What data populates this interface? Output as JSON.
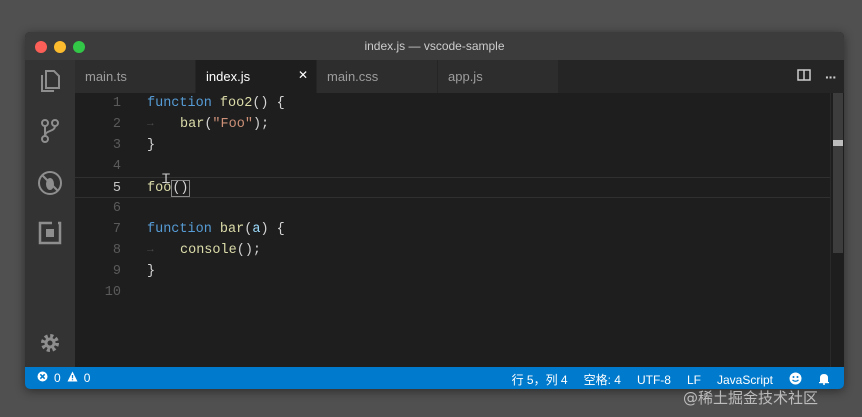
{
  "window": {
    "title": "index.js — vscode-sample"
  },
  "tabs": [
    {
      "label": "main.ts",
      "active": false
    },
    {
      "label": "index.js",
      "active": true
    },
    {
      "label": "main.css",
      "active": false
    },
    {
      "label": "app.js",
      "active": false
    }
  ],
  "tab_close_glyph": "✕",
  "tab_actions": {
    "split_icon": "split-editor-icon",
    "more_label": "···"
  },
  "activity_icons": [
    "files-icon",
    "source-control-icon",
    "debug-icon",
    "extensions-icon",
    "gear-icon"
  ],
  "editor": {
    "current_line": 5,
    "lines": [
      {
        "number": "1"
      },
      {
        "number": "2"
      },
      {
        "number": "3"
      },
      {
        "number": "4"
      },
      {
        "number": "5"
      },
      {
        "number": "6"
      },
      {
        "number": "7"
      },
      {
        "number": "8"
      },
      {
        "number": "9"
      },
      {
        "number": "10"
      }
    ],
    "tokens": {
      "l1_kw": "function",
      "l1_fn": "foo2",
      "l1_rest": "() {",
      "l2_fn": "bar",
      "l2_p1": "(",
      "l2_str": "\"Foo\"",
      "l2_p2": ");",
      "l3": "}",
      "l5_text": "foo",
      "l5_box": "()",
      "l7_kw": "function",
      "l7_fn": "bar",
      "l7_p1": "(",
      "l7_param": "a",
      "l7_p2": ") {",
      "l8_fn": "console",
      "l8_rest": "();",
      "l9": "}"
    },
    "indent_guide": "→"
  },
  "statusbar": {
    "errors": "0",
    "warnings": "0",
    "position": "行 5，列 4",
    "spaces": "空格: 4",
    "encoding": "UTF-8",
    "eol": "LF",
    "language": "JavaScript"
  },
  "cursor_glyph": "Ꮖ",
  "watermark": "@稀土掘金技术社区",
  "colors": {
    "statusbar": "#007acc",
    "keyword": "#569cd6",
    "function": "#dcdcaa",
    "string": "#ce9178"
  }
}
